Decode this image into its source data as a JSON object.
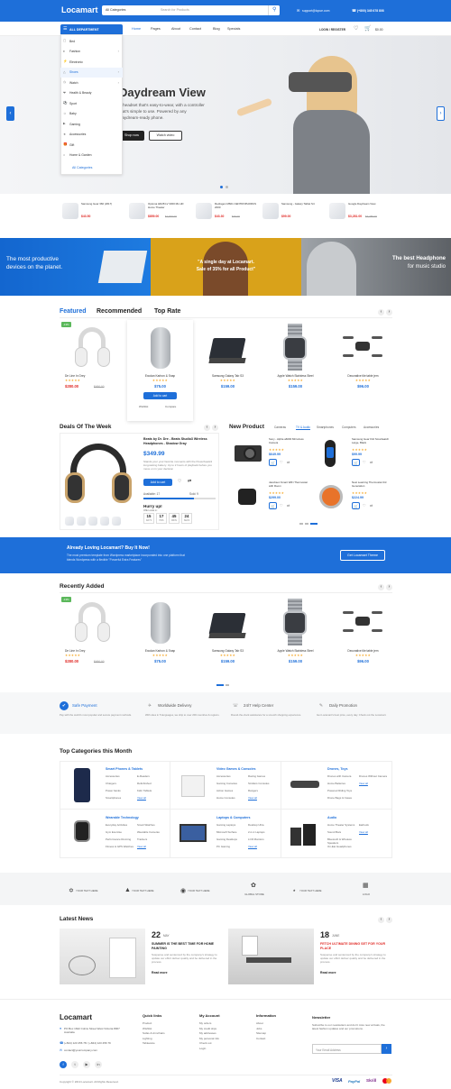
{
  "header": {
    "logo": "Locamart",
    "search_category": "All Categories",
    "search_placeholder": "Search for Products",
    "email": "support@lopue.com",
    "phone": "(+800) 345 678 808",
    "cart_label": "$0.00",
    "login_label": "LOGIN / REGISTER",
    "cart_count": "0",
    "wish_count": "0"
  },
  "nav": {
    "department": "ALL DEPARTMENT",
    "items": [
      "Home",
      "Pages",
      "About",
      "Contact",
      "Blog",
      "Specials"
    ]
  },
  "categories": [
    "Bed",
    "Fashion",
    "Electronic",
    "Shoes",
    "Watch",
    "Health & Beauty",
    "Sport",
    "Baby",
    "Gaming",
    "Accessories",
    "Gift",
    "Home & Garden"
  ],
  "categories_all": "All Categories",
  "hero": {
    "title": "Daydream View",
    "desc1": "A headset that's easy-to-wear, with a controller",
    "desc2": "that's simple to use. Powered by any",
    "desc3": "Daydream-ready phone.",
    "btn1": "Shop now",
    "btn2": "Watch video"
  },
  "mini_products": [
    {
      "name": "Samsung Gear 360 (2017)",
      "price": "$43.50",
      "old": ""
    },
    {
      "name": "Optoma HD28 LV 3300 ML HD Home Theater",
      "price": "$859.00",
      "old": "$1,000.00"
    },
    {
      "name": "Redragon M601 CENTROPHORUS 2000",
      "price": "$43.30",
      "old": "$49.00"
    },
    {
      "name": "Samsung - Galaxy Tablet S4",
      "price": "$99.00",
      "old": ""
    },
    {
      "name": "Google Daydream View",
      "price": "$3,281.00",
      "old": "$3,285.00"
    }
  ],
  "banners": [
    {
      "line1": "The most productive",
      "line2": "devices on the planet."
    },
    {
      "line1": "\"A single day at Locamart.",
      "line2": "Sale of 35% for all Product\""
    },
    {
      "line1": "The best Headphone",
      "line2": "for music studio"
    }
  ],
  "featured_tabs": [
    "Featured",
    "Recommended",
    "Top Rate"
  ],
  "featured_products": [
    {
      "name": "De Line In Grey",
      "price": "$280.00",
      "old": "$490.00",
      "badge": "-13%"
    },
    {
      "name": "Exodan Karbon & Snap",
      "price": "$75.00",
      "old": "",
      "badge": ""
    },
    {
      "name": "Samsung Galaxy Tab S3",
      "price": "$159.00",
      "old": "",
      "badge": ""
    },
    {
      "name": "Apple Watch Stainless Steel",
      "price": "$159.00",
      "old": "",
      "badge": ""
    },
    {
      "name": "Decorative tile table jern",
      "price": "$96.00",
      "old": "",
      "badge": ""
    }
  ],
  "add_to_cart": "Add to cart",
  "wishlist": "Wishlist",
  "compare": "Compare",
  "deals": {
    "title": "Deals Of The Week",
    "product": "Beats by Dr. Dre - Beats Studio3 Wireless Headphones - Shadow Gray",
    "price": "$349.99",
    "desc": "Stands your your favorite moments with the Powerbeats3 long-lasting battery. Up to 2 hours of playback before you move on in your decision",
    "available": "Available: 17",
    "sold": "Sold: 9",
    "hurry": "Hurry up!",
    "offer": "Offer ends in:",
    "timer": [
      {
        "v": "15",
        "l": "DAYS"
      },
      {
        "v": "17",
        "l": "HRS"
      },
      {
        "v": "45",
        "l": "MINS"
      },
      {
        "v": "24",
        "l": "SECS"
      }
    ]
  },
  "new_product": {
    "title": "New Product",
    "tabs": [
      "Cameras",
      "TV & Audio",
      "Smartphones",
      "Computers",
      "Accessories"
    ],
    "items": [
      {
        "name": "Sony - Alpha a6000 Mirrorless Camera",
        "price": "$649.99",
        "old": ""
      },
      {
        "name": "Samsung Gear Fit2 Smartwatch Large, Black",
        "price": "$99.99",
        "old": ""
      },
      {
        "name": "Jacobsen Smart WiFi Thermostat with Room",
        "price": "$299.00",
        "old": ""
      },
      {
        "name": "Nest Learning Thermostat 3rd Generation",
        "price": "$224.99",
        "old": ""
      }
    ]
  },
  "cta": {
    "title": "Already Loving Locamart? Buy It Now!",
    "text1": "The most premium template from Wordpress marketplace incorporated into one platform that",
    "text2": "blends Wordpress with a flexible \"Powerful Extra Features\"",
    "btn": "Get Locamart Theme"
  },
  "recently": {
    "title": "Recently Added"
  },
  "services": [
    {
      "title": "Safe Payment",
      "text": "Pay with the world's most popular and secure payment methods."
    },
    {
      "title": "Worldwide Delivery",
      "text": "With sites in 5 languages, we ship to over 200 countries & regions."
    },
    {
      "title": "24/7 Help Center",
      "text": "Round-the-clock assistance for a smooth shopping experience."
    },
    {
      "title": "Daily Promotion",
      "text": "Get Locamart's best price, every day. Check out the Locamart."
    }
  ],
  "top_categories": {
    "title": "Top Categories this Month",
    "view_all": "View all",
    "items": [
      {
        "name": "Smart Phones & Tablets",
        "links": [
          "Accessories",
          "Chargers",
          "Power banks",
          "Smartphones",
          "E-Readers",
          "Refurbished",
          "Kids' Tablets",
          "View all"
        ]
      },
      {
        "name": "Video Games & Consoles",
        "links": [
          "Accessories",
          "Gaming Consoles",
          "Action Games",
          "Home Consoles",
          "Racing Games",
          "Strollers Consoles",
          "Rangers",
          "View all"
        ]
      },
      {
        "name": "Drones, Toys",
        "links": [
          "Drones with Camera",
          "Home Batteries",
          "Powered Riding Toys",
          "Drone Bags & Cases",
          "Drones Without Camera",
          "View all"
        ]
      },
      {
        "name": "Wearable Technology",
        "links": [
          "Everyday Activities",
          "Gym Exercise",
          "Performance Running",
          "Fitness & GPS Watches",
          "Smart Watches",
          "Wearable Cameras",
          "Trackers",
          "View all"
        ]
      },
      {
        "name": "Laptops & Computers",
        "links": [
          "Gaming Laptops",
          "Microsoft Surface",
          "Gaming Desktops",
          "PC Gaming",
          "Desktop Ultra",
          "2-in-1 Laptops",
          "LCD Monitors",
          "View all"
        ]
      },
      {
        "name": "Audio",
        "links": [
          "Home Theater Systems",
          "Sound Bars",
          "Bluetooth & Wireless Speakers",
          "On-Ear Headphones",
          "Earbuds",
          "View all"
        ]
      }
    ]
  },
  "brands": [
    "YOUR TEXT HERE",
    "YOUR TEXT HERE",
    "YOUR TEXT HERE",
    "GLOBAL STORE",
    "YOUR TEXT HERE",
    "LOGO"
  ],
  "news": {
    "title": "Latest News",
    "posts": [
      {
        "day": "22",
        "month": "MAY",
        "title": "SUMMER IS THE BEST TIME FOR HOME PAINTING",
        "text": "Suspense and sentenced by the company's strategy to update our effort deliver quality and be delivered in the process.",
        "more": "Read more"
      },
      {
        "day": "18",
        "month": "JUNE",
        "title": "FETCH ULTIMATE DINING SET FOR YOUR PLACE",
        "text": "Suspense and sentenced by the company's strategy to update our effort deliver quality and be delivered in the process.",
        "more": "Read more"
      }
    ]
  },
  "footer": {
    "logo": "Locamart",
    "address": "PO Box 1622 Colins Street West Victoria 8007 Australia",
    "phone": "(+844) 123 456 78 / (+844) 123 456 79",
    "email": "contact@yourcompany.com",
    "cols": [
      {
        "title": "Quick links",
        "links": [
          "Product",
          "Wishlist",
          "Sofas & Armchairs",
          "Lighting",
          "Tableware"
        ]
      },
      {
        "title": "My Account",
        "links": [
          "My orders",
          "My credit slips",
          "My addresses",
          "My personal info",
          "Check out",
          "Login"
        ]
      },
      {
        "title": "Information",
        "links": [
          "About",
          "Jobs",
          "Sitemap",
          "Contact"
        ]
      }
    ],
    "newsletter_title": "Newsletter",
    "newsletter_text": "Subscribe to our newsletters and don't miss new arrivals, the latest fashion updates and our promotions.",
    "newsletter_placeholder": "Your Email Address",
    "copyright": "Copyright © 2019 Locamart. All Rights Reserved.",
    "payments": [
      "VISA",
      "PayPal",
      "Skrill"
    ]
  }
}
